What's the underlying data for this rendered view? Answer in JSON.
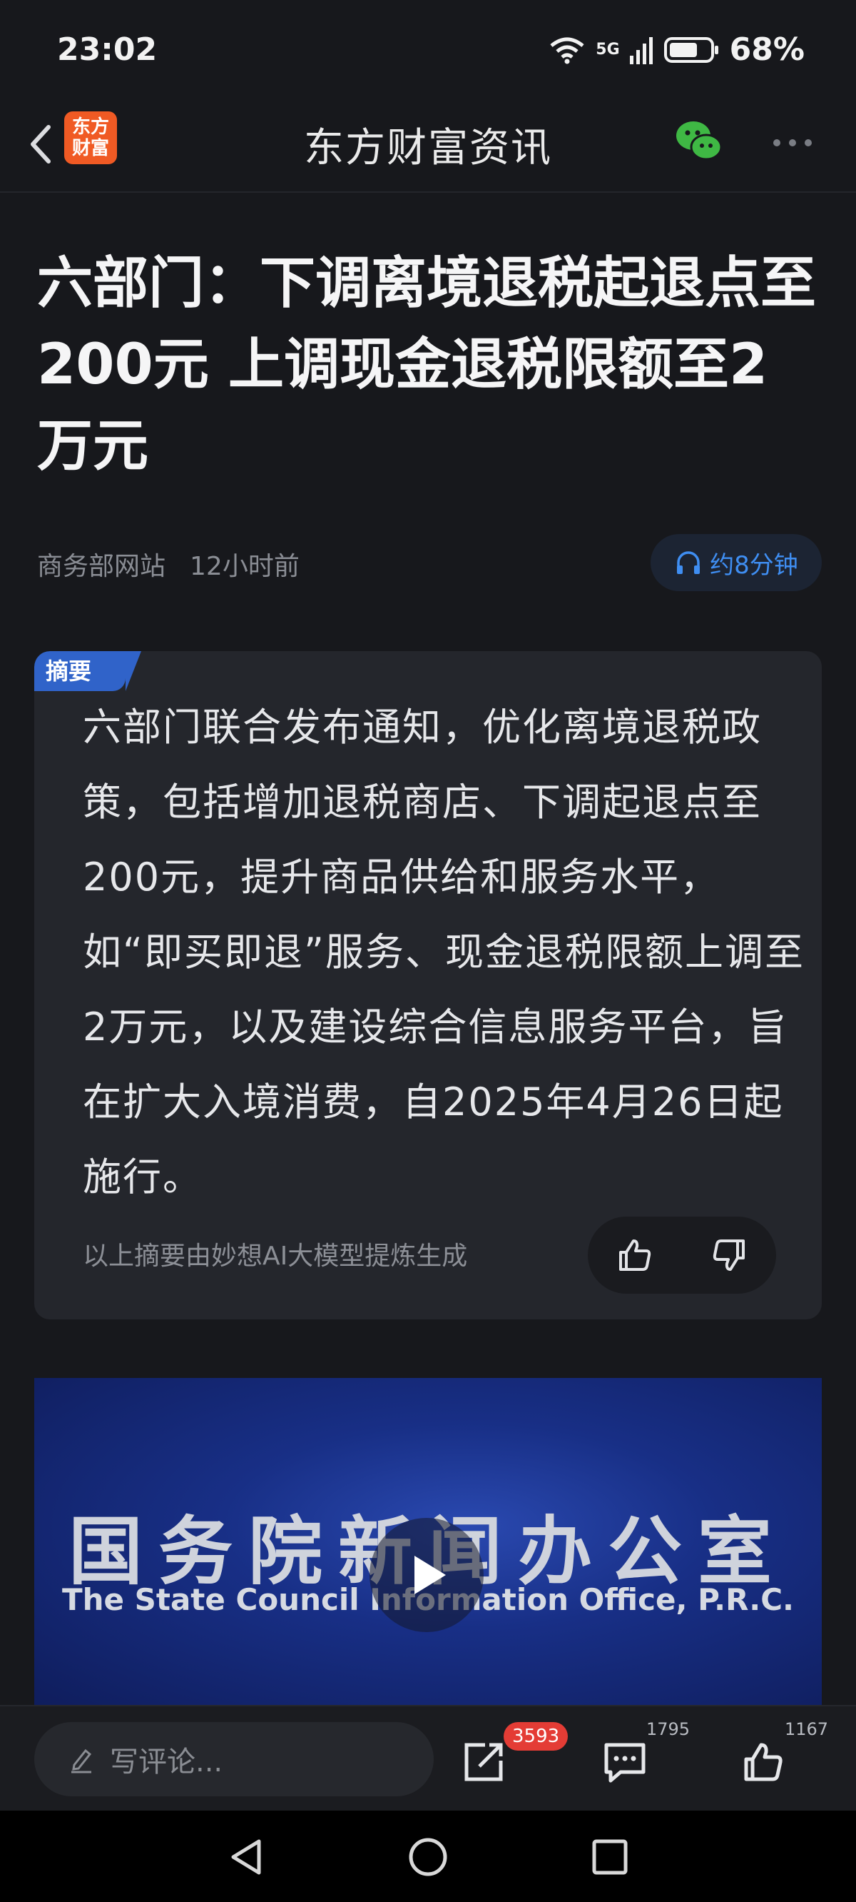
{
  "status_bar": {
    "time": "23:02",
    "battery_percent": "68%",
    "network": "5G"
  },
  "header": {
    "logo_text_line1": "东方",
    "logo_text_line2": "财富",
    "title": "东方财富资讯"
  },
  "article": {
    "title": "六部门：下调离境退税起退点至200元 上调现金退税限额至2万元",
    "source": "商务部网站",
    "time_ago": "12小时前",
    "listen_label": "约8分钟"
  },
  "summary": {
    "tag": "摘要",
    "text": "六部门联合发布通知，优化离境退税政策，包括增加退税商店、下调起退点至200元，提升商品供给和服务水平，如“即买即退”服务、现金退税限额上调至2万元，以及建设综合信息服务平台，旨在扩大入境消费，自2025年4月26日起施行。",
    "ai_note": "以上摘要由妙想AI大模型提炼生成"
  },
  "video": {
    "title_cn": "国务院新闻办公室",
    "title_en": "The State Council Information Office, P.R.C."
  },
  "bottom_bar": {
    "comment_placeholder": "写评论...",
    "share_count": "3593",
    "comment_count": "1795",
    "like_count": "1167"
  },
  "colors": {
    "background": "#17181c",
    "accent_blue": "#3063c9",
    "logo_orange": "#f05a24",
    "badge_red": "#e43c35"
  }
}
